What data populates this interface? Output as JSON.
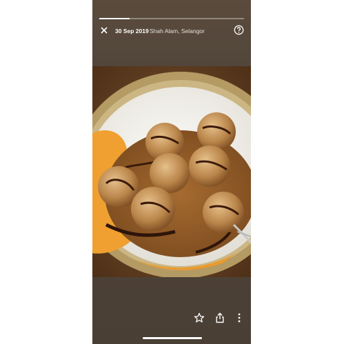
{
  "story": {
    "progress": 0.21
  },
  "header": {
    "date": "30 Sep 2019",
    "location": "Shah Alam, Selangor",
    "close_icon": "close-icon",
    "help_icon": "help-icon"
  },
  "photo": {
    "subject_icon": "photo"
  },
  "actions": {
    "star_icon": "star-icon",
    "share_icon": "share-icon",
    "more_icon": "more-vertical-icon"
  },
  "colors": {
    "background": "#4f4338",
    "text": "#ffffff",
    "plate": "#f2f0ea"
  }
}
